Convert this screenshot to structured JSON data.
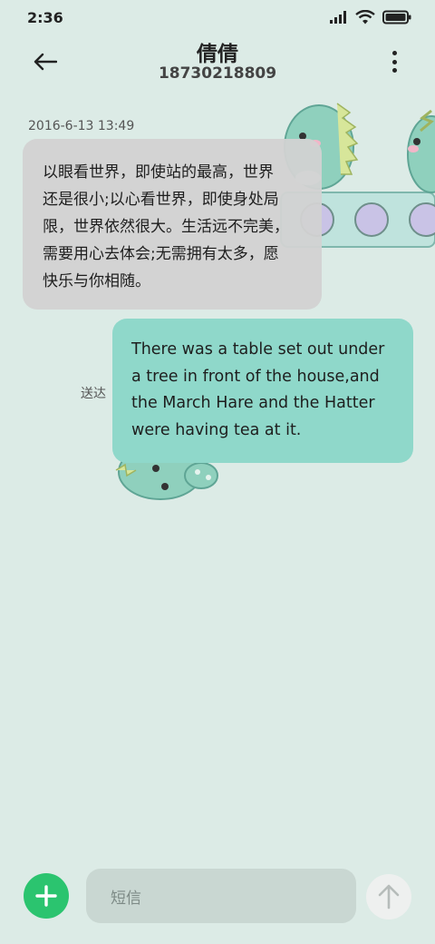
{
  "status_bar": {
    "time": "2:36",
    "icons": [
      "signal-icon",
      "wifi-icon",
      "battery-icon"
    ]
  },
  "header": {
    "contact_name": "倩倩",
    "contact_number": "18730218809",
    "back_icon": "back-arrow-icon",
    "menu_icon": "more-vertical-icon"
  },
  "conversation": {
    "timestamp": "2016-6-13 13:49",
    "received": {
      "lines": [
        "以眼看世界，即使站的最高，世界",
        "还是很小;以心看世界，即使身处局",
        "限，世界依然很大。生活远不完美，",
        "需要用心去体会;无需拥有太多，愿",
        "快乐与你相随。"
      ]
    },
    "sent": {
      "lines": [
        "There was a table set out under",
        "a tree in front of the house,and",
        "the March Hare and the Hatter",
        "were having tea at it."
      ],
      "status": "送达"
    }
  },
  "composer": {
    "placeholder": "短信",
    "add_icon": "plus-icon",
    "send_icon": "send-arrow-icon"
  },
  "colors": {
    "background": "#dcebe6",
    "received_bubble": "#d2d2d2",
    "sent_bubble": "#8fd8ca",
    "add_button": "#2bc46f"
  }
}
